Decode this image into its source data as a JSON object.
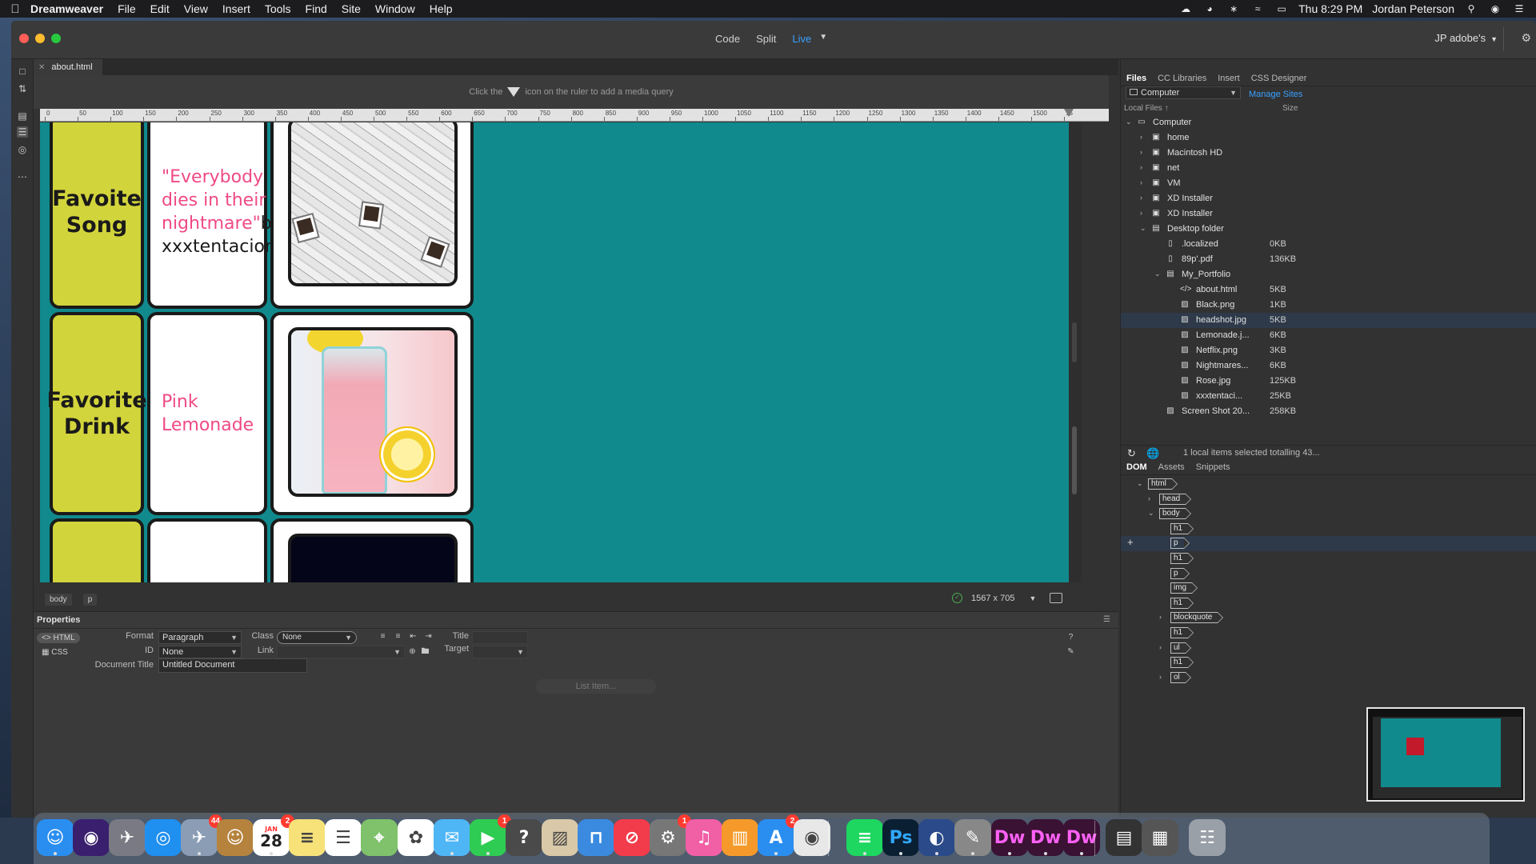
{
  "menubar": {
    "app_name": "Dreamweaver",
    "menus": [
      "File",
      "Edit",
      "View",
      "Insert",
      "Tools",
      "Find",
      "Site",
      "Window",
      "Help"
    ],
    "clock": "Thu 8:29 PM",
    "user": "Jordan Peterson"
  },
  "window": {
    "views": [
      "Code",
      "Split",
      "Live"
    ],
    "active_view": "Live",
    "account": "JP adobe's",
    "doc_tab": "about.html"
  },
  "media_query_hint": {
    "before": "Click the",
    "after": "icon on the ruler to add a media query"
  },
  "ruler": {
    "labels": [
      "0",
      "50",
      "100",
      "150",
      "200",
      "250",
      "300",
      "350",
      "400",
      "450",
      "500",
      "550",
      "600",
      "650",
      "700",
      "750",
      "800",
      "850",
      "900",
      "950",
      "1000",
      "1050",
      "1100",
      "1150",
      "1200",
      "1250",
      "1300",
      "1350",
      "1400",
      "1450",
      "1500",
      "15"
    ]
  },
  "live_content": {
    "rows": [
      {
        "label": "Favoite Song",
        "text_pink": "\"Everybody dies in their nightmare\"",
        "text_black": "by xxxtentacion",
        "image": "nightmare-lyrics-photo"
      },
      {
        "label": "Favorite Drink",
        "text_pink": "Pink Lemonade",
        "text_black": "",
        "image": "pink-lemonade-photo"
      },
      {
        "label": "",
        "text_pink": "",
        "text_black": "",
        "image": "dark-photo"
      }
    ]
  },
  "tag_selector": {
    "tags": [
      "body",
      "p"
    ],
    "size": "1567 x 705"
  },
  "properties": {
    "title": "Properties",
    "modes": [
      "HTML",
      "CSS"
    ],
    "format_label": "Format",
    "format_value": "Paragraph",
    "id_label": "ID",
    "id_value": "None",
    "class_label": "Class",
    "class_value": "None",
    "link_label": "Link",
    "title_label": "Title",
    "target_label": "Target",
    "doc_title_label": "Document Title",
    "doc_title_value": "Untitled Document",
    "list_item_button": "List Item..."
  },
  "files_panel": {
    "tabs": [
      "Files",
      "CC Libraries",
      "Insert",
      "CSS Designer"
    ],
    "location": "Computer",
    "manage_sites": "Manage Sites",
    "header_local": "Local Files",
    "header_size": "Size",
    "tree": [
      {
        "name": "Computer",
        "size": ""
      },
      {
        "name": "home",
        "size": ""
      },
      {
        "name": "Macintosh HD",
        "size": ""
      },
      {
        "name": "net",
        "size": ""
      },
      {
        "name": "VM",
        "size": ""
      },
      {
        "name": "XD Installer",
        "size": ""
      },
      {
        "name": "XD Installer",
        "size": ""
      },
      {
        "name": "Desktop folder",
        "size": ""
      },
      {
        "name": ".localized",
        "size": "0KB"
      },
      {
        "name": "89p'.pdf",
        "size": "136KB"
      },
      {
        "name": "My_Portfolio",
        "size": ""
      },
      {
        "name": "about.html",
        "size": "5KB"
      },
      {
        "name": "Black.png",
        "size": "1KB"
      },
      {
        "name": "headshot.jpg",
        "size": "5KB"
      },
      {
        "name": "Lemonade.j...",
        "size": "6KB"
      },
      {
        "name": "Netflix.png",
        "size": "3KB"
      },
      {
        "name": "Nightmares...",
        "size": "6KB"
      },
      {
        "name": "Rose.jpg",
        "size": "125KB"
      },
      {
        "name": "xxxtentaci...",
        "size": "25KB"
      },
      {
        "name": "Screen Shot 20...",
        "size": "258KB"
      }
    ],
    "status": "1 local items selected totalling 43..."
  },
  "dom_panel": {
    "tabs": [
      "DOM",
      "Assets",
      "Snippets"
    ],
    "nodes": [
      "html",
      "head",
      "body",
      "h1",
      "p",
      "h1",
      "p",
      "img",
      "h1",
      "blockquote",
      "h1",
      "ul",
      "h1",
      "ol"
    ]
  },
  "dock": {
    "badges": {
      "pilot": "44",
      "calendar_day": "28",
      "calendar_badge": "2",
      "facetime": "1",
      "prefs": "1",
      "appstore": "2"
    },
    "labels": {
      "photoshop": "Ps",
      "dw1": "Dw",
      "dw2": "Dw",
      "dw3": "Dw",
      "calendar_month": "JAN"
    }
  },
  "colors": {
    "teal_bg": "#118a8d",
    "yellow_cell": "#d2d43b",
    "pink_text": "#ef4a86",
    "accent_blue": "#3aa0ff"
  }
}
